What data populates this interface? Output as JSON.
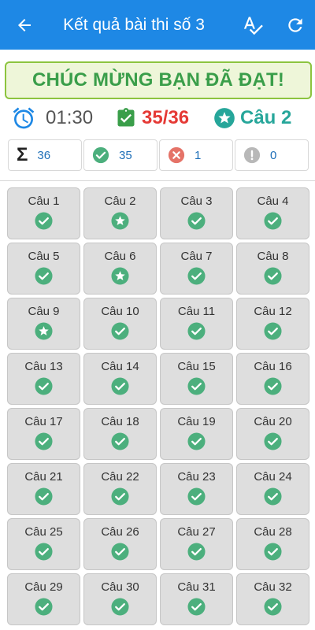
{
  "appbar": {
    "title": "Kết quả bài thi số 3"
  },
  "banner": {
    "text": "CHÚC MỪNG BẠN ĐÃ ĐẠT!"
  },
  "stats": {
    "time": "01:30",
    "score": "35/36",
    "star_question": "Câu 2"
  },
  "counts": {
    "total": "36",
    "correct": "35",
    "wrong": "1",
    "unanswered": "0"
  },
  "colors": {
    "appbar": "#1e88e5",
    "correct": "#4caf7d",
    "wrong": "#e57368",
    "score": "#e53935",
    "star": "#26a69a",
    "banner_text": "#3a9e4a"
  },
  "questions": [
    {
      "label": "Câu 1",
      "status": "check"
    },
    {
      "label": "Câu 2",
      "status": "star"
    },
    {
      "label": "Câu 3",
      "status": "check"
    },
    {
      "label": "Câu 4",
      "status": "check"
    },
    {
      "label": "Câu 5",
      "status": "check"
    },
    {
      "label": "Câu 6",
      "status": "star"
    },
    {
      "label": "Câu 7",
      "status": "check"
    },
    {
      "label": "Câu 8",
      "status": "check"
    },
    {
      "label": "Câu 9",
      "status": "star"
    },
    {
      "label": "Câu 10",
      "status": "check"
    },
    {
      "label": "Câu 11",
      "status": "check"
    },
    {
      "label": "Câu 12",
      "status": "check"
    },
    {
      "label": "Câu 13",
      "status": "check"
    },
    {
      "label": "Câu 14",
      "status": "check"
    },
    {
      "label": "Câu 15",
      "status": "check"
    },
    {
      "label": "Câu 16",
      "status": "check"
    },
    {
      "label": "Câu 17",
      "status": "check"
    },
    {
      "label": "Câu 18",
      "status": "check"
    },
    {
      "label": "Câu 19",
      "status": "check"
    },
    {
      "label": "Câu 20",
      "status": "check"
    },
    {
      "label": "Câu 21",
      "status": "check"
    },
    {
      "label": "Câu 22",
      "status": "check"
    },
    {
      "label": "Câu 23",
      "status": "check"
    },
    {
      "label": "Câu 24",
      "status": "check"
    },
    {
      "label": "Câu 25",
      "status": "check"
    },
    {
      "label": "Câu 26",
      "status": "check"
    },
    {
      "label": "Câu 27",
      "status": "check"
    },
    {
      "label": "Câu 28",
      "status": "check"
    },
    {
      "label": "Câu 29",
      "status": "check"
    },
    {
      "label": "Câu 30",
      "status": "check"
    },
    {
      "label": "Câu 31",
      "status": "check"
    },
    {
      "label": "Câu 32",
      "status": "check"
    }
  ]
}
